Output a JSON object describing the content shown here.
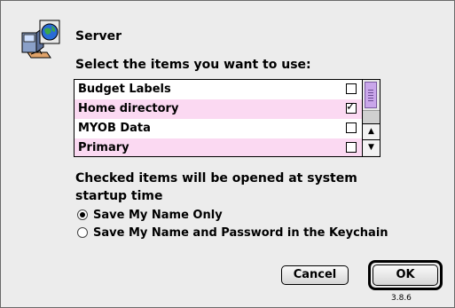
{
  "dialog": {
    "title": "Server",
    "prompt": "Select the items you want to use:",
    "items": [
      {
        "label": "Budget Labels",
        "checked": false,
        "highlight": false
      },
      {
        "label": "Home directory",
        "checked": true,
        "highlight": true
      },
      {
        "label": "MYOB Data",
        "checked": false,
        "highlight": false
      },
      {
        "label": "Primary",
        "checked": false,
        "highlight": true
      }
    ],
    "description": "Checked items will be opened at system startup time",
    "radio_options": [
      {
        "label": "Save My Name Only",
        "selected": true
      },
      {
        "label": "Save My Name and Password in the Keychain",
        "selected": false
      }
    ],
    "cancel_label": "Cancel",
    "ok_label": "OK",
    "version": "3.8.6",
    "check_glyph": "✓",
    "up_arrow": "▲",
    "down_arrow": "▼"
  },
  "colors": {
    "row_highlight": "#fbd9f2",
    "scroll_thumb": "#c9a6ea",
    "background": "#ececec"
  },
  "icons": [
    "server-globe-icon",
    "checkbox-icon",
    "radio-icon",
    "scroll-up-arrow-icon",
    "scroll-down-arrow-icon"
  ]
}
